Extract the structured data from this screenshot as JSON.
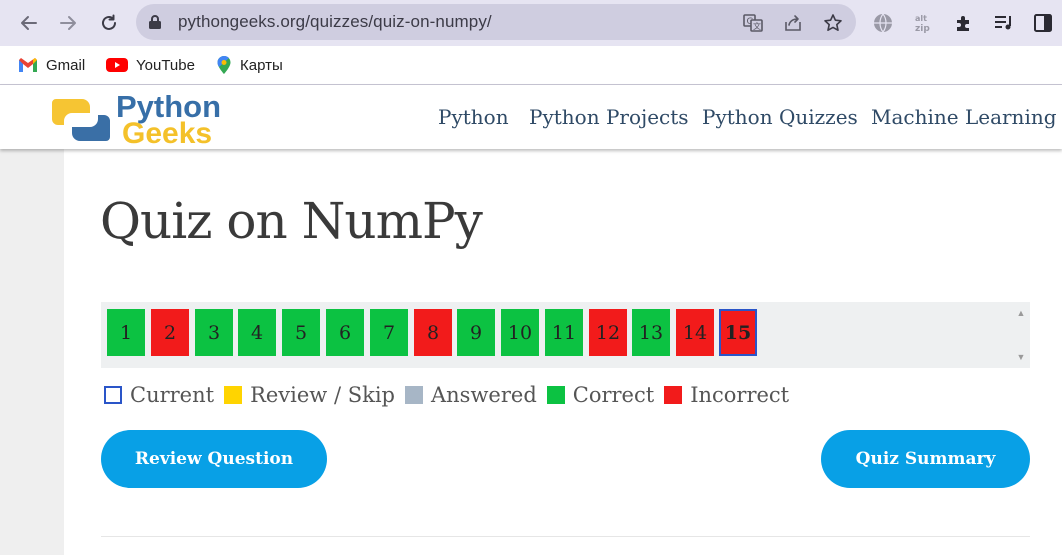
{
  "browser": {
    "url": "pythongeeks.org/quizzes/quiz-on-numpy/",
    "bookmarks": [
      {
        "label": "Gmail",
        "icon": "gmail-icon"
      },
      {
        "label": "YouTube",
        "icon": "youtube-icon"
      },
      {
        "label": "Карты",
        "icon": "maps-icon"
      }
    ]
  },
  "site": {
    "logo": {
      "word1": "Python",
      "word2": "Geeks"
    },
    "nav": [
      "Python",
      "Python Projects",
      "Python Quizzes",
      "Machine Learning"
    ]
  },
  "quiz": {
    "title": "Quiz on NumPy",
    "questions": [
      {
        "n": "1",
        "status": "correct"
      },
      {
        "n": "2",
        "status": "incorrect"
      },
      {
        "n": "3",
        "status": "correct"
      },
      {
        "n": "4",
        "status": "correct"
      },
      {
        "n": "5",
        "status": "correct"
      },
      {
        "n": "6",
        "status": "correct"
      },
      {
        "n": "7",
        "status": "correct"
      },
      {
        "n": "8",
        "status": "incorrect"
      },
      {
        "n": "9",
        "status": "correct"
      },
      {
        "n": "10",
        "status": "correct"
      },
      {
        "n": "11",
        "status": "correct"
      },
      {
        "n": "12",
        "status": "incorrect"
      },
      {
        "n": "13",
        "status": "correct"
      },
      {
        "n": "14",
        "status": "incorrect"
      },
      {
        "n": "15",
        "status": "incorrect",
        "current": true
      }
    ],
    "legend": [
      {
        "label": "Current",
        "color": "#ffffff",
        "border": "#2a55c8"
      },
      {
        "label": "Review / Skip",
        "color": "#ffd400"
      },
      {
        "label": "Answered",
        "color": "#a7b6c6"
      },
      {
        "label": "Correct",
        "color": "#0cc242"
      },
      {
        "label": "Incorrect",
        "color": "#f21b1b"
      }
    ],
    "buttons": {
      "review": "Review Question",
      "summary": "Quiz Summary"
    }
  },
  "colors": {
    "accent": "#08a0e6",
    "correct": "#0cc242",
    "incorrect": "#f21b1b"
  }
}
